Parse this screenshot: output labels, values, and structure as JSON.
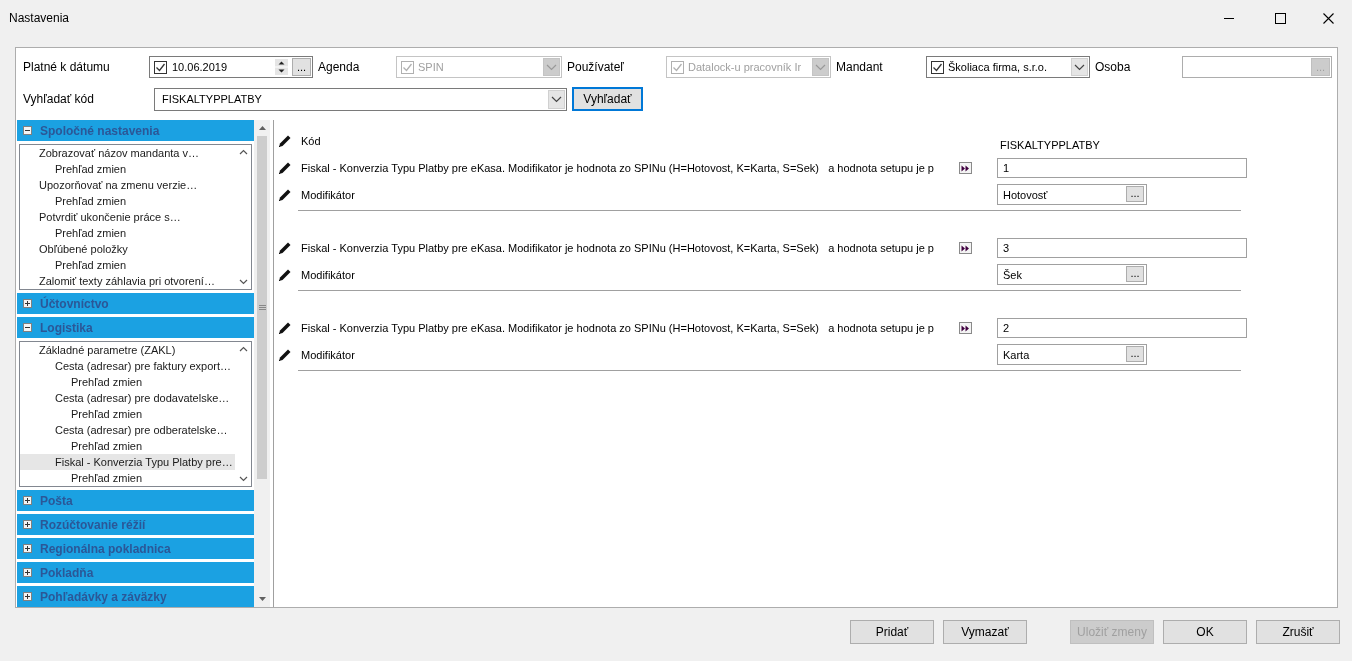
{
  "window": {
    "title": "Nastavenia"
  },
  "filters": [
    {
      "kind": "date",
      "label": "Platné k dátumu",
      "checked": true,
      "value": "10.06.2019",
      "button": "...",
      "disabled": false
    },
    {
      "kind": "combo",
      "label": "Agenda",
      "checked": true,
      "value": "SPIN",
      "disabled": true
    },
    {
      "kind": "combo",
      "label": "Používateľ",
      "checked": true,
      "value": "Datalock-u pracovník Ir",
      "disabled": true
    },
    {
      "kind": "combo",
      "label": "Mandant",
      "checked": true,
      "value": "Školiaca firma, s.r.o.",
      "disabled": false
    },
    {
      "kind": "lookup",
      "label": "Osoba",
      "button": "...",
      "disabled": true
    }
  ],
  "search": {
    "label": "Vyhľadať kód",
    "value": "FISKALTYPPLATBY",
    "button": "Vyhľadať"
  },
  "sections": [
    {
      "title": "Spoločné nastavenia",
      "expanded": true,
      "items": [
        {
          "label": "Zobrazovať názov mandanta v…",
          "selected": false,
          "children": [
            {
              "label": "Prehľad zmien",
              "selected": false
            }
          ]
        },
        {
          "label": "Upozorňovať na zmenu verzie…",
          "selected": false,
          "children": [
            {
              "label": "Prehľad zmien",
              "selected": false
            }
          ]
        },
        {
          "label": "Potvrdiť ukončenie práce s…",
          "selected": false,
          "children": [
            {
              "label": "Prehľad zmien",
              "selected": false
            }
          ]
        },
        {
          "label": "Obľúbené položky",
          "selected": false,
          "children": [
            {
              "label": "Prehľad zmien",
              "selected": false
            }
          ]
        },
        {
          "label": "Zalomiť texty záhlavia pri otvorení…",
          "selected": false
        }
      ]
    },
    {
      "title": "Účtovníctvo",
      "expanded": false
    },
    {
      "title": "Logistika",
      "expanded": true,
      "items": [
        {
          "label": "Základné parametre (ZAKL)",
          "selected": false,
          "children": [
            {
              "label": "Cesta (adresar) pre faktury export…",
              "selected": false,
              "children": [
                {
                  "label": "Prehľad zmien",
                  "selected": false
                }
              ]
            },
            {
              "label": "Cesta (adresar) pre dodavatelske…",
              "selected": false,
              "children": [
                {
                  "label": "Prehľad zmien",
                  "selected": false
                }
              ]
            },
            {
              "label": "Cesta (adresar) pre odberatelske…",
              "selected": false,
              "children": [
                {
                  "label": "Prehľad zmien",
                  "selected": false
                }
              ]
            },
            {
              "label": "Fiskal - Konverzia Typu Platby pre…",
              "selected": true,
              "children": [
                {
                  "label": "Prehľad zmien",
                  "selected": false
                }
              ]
            }
          ]
        }
      ]
    },
    {
      "title": "Pošta",
      "expanded": false
    },
    {
      "title": "Rozúčtovanie réžií",
      "expanded": false
    },
    {
      "title": "Regionálna pokladnica",
      "expanded": false
    },
    {
      "title": "Pokladňa",
      "expanded": false
    },
    {
      "title": "Pohľadávky a záväzky",
      "expanded": false
    }
  ],
  "code_row": {
    "label": "Kód",
    "value": "FISKALTYPPLATBY"
  },
  "setting_groups": [
    {
      "description": "Fiskal - Konverzia Typu Platby pre eKasa. Modifikator je hodnota zo SPINu (H=Hotovost, K=Karta, S=Sek)   a hodnota setupu je p",
      "value": "1",
      "modifier_label": "Modifikátor",
      "modifier_value": "Hotovosť",
      "modifier_button": "..."
    },
    {
      "description": "Fiskal - Konverzia Typu Platby pre eKasa. Modifikator je hodnota zo SPINu (H=Hotovost, K=Karta, S=Sek)   a hodnota setupu je p",
      "value": "3",
      "modifier_label": "Modifikátor",
      "modifier_value": "Šek",
      "modifier_button": "..."
    },
    {
      "description": "Fiskal - Konverzia Typu Platby pre eKasa. Modifikator je hodnota zo SPINu (H=Hotovost, K=Karta, S=Sek)   a hodnota setupu je p",
      "value": "2",
      "modifier_label": "Modifikátor",
      "modifier_value": "Karta",
      "modifier_button": "..."
    }
  ],
  "buttons": [
    {
      "label": "Pridať",
      "disabled": false
    },
    {
      "label": "Vymazať",
      "disabled": false
    },
    {
      "label": "Uložiť zmeny",
      "disabled": true
    },
    {
      "label": "OK",
      "disabled": false
    },
    {
      "label": "Zrušiť",
      "disabled": false
    }
  ]
}
